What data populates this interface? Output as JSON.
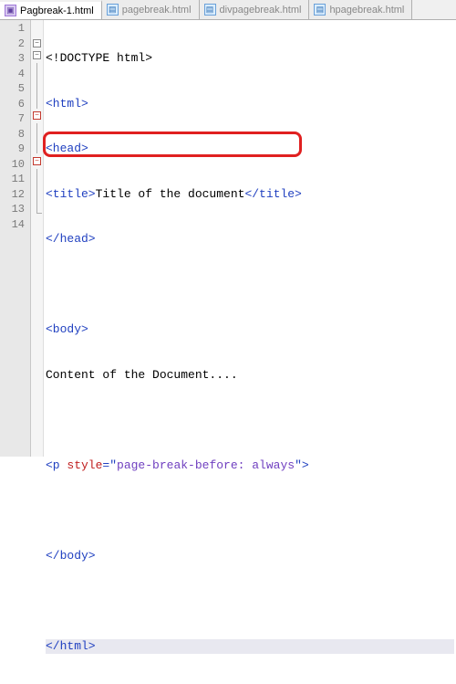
{
  "tabs": [
    {
      "label": "Pagbreak-1.html",
      "active": true,
      "dirty": true
    },
    {
      "label": "pagebreak.html",
      "active": false
    },
    {
      "label": "divpagebreak.html",
      "active": false
    },
    {
      "label": "hpagebreak.html",
      "active": false
    }
  ],
  "gutter": [
    "1",
    "2",
    "3",
    "4",
    "5",
    "6",
    "7",
    "8",
    "9",
    "10",
    "11",
    "12",
    "13",
    "14"
  ],
  "code": {
    "l1": {
      "decl": "<!DOCTYPE html>"
    },
    "l2": {
      "tagO": "<html>"
    },
    "l3": {
      "tagO": "<head>"
    },
    "l4": {
      "tagO": "<title>",
      "txt": "Title of the document",
      "tagC": "</title>"
    },
    "l5": {
      "tagC": "</head>"
    },
    "l6": {
      "blank": ""
    },
    "l7": {
      "tagO": "<body>"
    },
    "l8": {
      "txt": "Content of the Document...."
    },
    "l9": {
      "blank": ""
    },
    "l10": {
      "p_open": "<p ",
      "attr": "style",
      "eqq": "=\"",
      "val": "page-break-before: always",
      "qclose": "\">"
    },
    "l11": {
      "blank": ""
    },
    "l12": {
      "tagC": "</body>"
    },
    "l13": {
      "blank": ""
    },
    "l14": {
      "tagC": "</html>"
    }
  },
  "foldglyph": "−"
}
